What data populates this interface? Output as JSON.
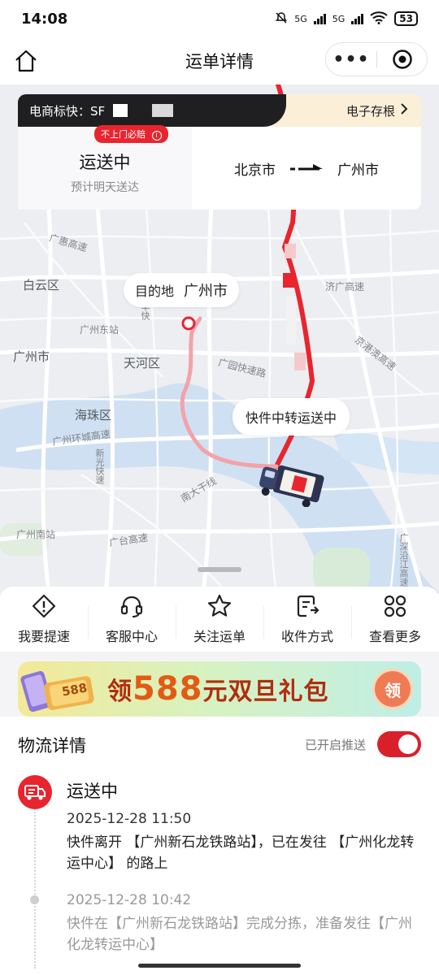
{
  "status_bar": {
    "time": "14:08",
    "network1": "5G",
    "network2": "5G",
    "battery": "53"
  },
  "nav": {
    "title": "运单详情",
    "more": "•••",
    "icons": [
      "home-icon",
      "more-icon",
      "target-icon"
    ]
  },
  "shipment": {
    "waybill_label": "电商标快：SF",
    "waybill_visible_tail": "",
    "e_receipt": "电子存根",
    "badge": "不上门必赔",
    "status": "运送中",
    "eta": "预计明天送达",
    "origin": "北京市",
    "destination": "广州市"
  },
  "map": {
    "destination_prefix": "目的地",
    "destination_city": "广州市",
    "transit_text": "快件中转运送中",
    "labels": {
      "baiyun": "白云区",
      "guangzhou": "广州市",
      "tianhe": "天河区",
      "haizhu": "海珠区",
      "east_station": "广州东站",
      "south_station": "广州南站",
      "jiguang": "济广高速",
      "guangyuan": "广园快速路",
      "huanchengg": "广州环城高速",
      "nanda": "南大干线",
      "guangtai": "广台高速",
      "jinggangao": "京港澳高速",
      "guanghui": "广惠高速",
      "huagui": "华快",
      "xinguang": "新光快速",
      "shenyan": "广深沿江高速"
    },
    "route_color_done": "#e8252f",
    "route_color_todo": "#f3a3a8"
  },
  "actions": [
    {
      "label": "我要提速",
      "icon": "speed-alert-icon"
    },
    {
      "label": "客服中心",
      "icon": "headset-icon"
    },
    {
      "label": "关注运单",
      "icon": "star-icon"
    },
    {
      "label": "收件方式",
      "icon": "receive-method-icon"
    },
    {
      "label": "查看更多",
      "icon": "grid-more-icon"
    }
  ],
  "promo": {
    "prefix": "领",
    "amount": "588",
    "suffix": "元双旦礼包",
    "button": "领",
    "ticket_text": "588"
  },
  "logistics": {
    "title": "物流详情",
    "push_label": "已开启推送",
    "push_on": true,
    "events": [
      {
        "status": "运送中",
        "time": "2025-12-28 11:50",
        "desc": "快件离开 【广州新石龙铁路站】，已在发往 【广州化龙转运中心】 的路上"
      },
      {
        "time": "2025-12-28 10:42",
        "desc": "快件在【广州新石龙铁路站】完成分拣，准备发往【广州化龙转运中心】"
      }
    ]
  },
  "colors": {
    "brand_red": "#e8252f",
    "dark_bar": "#1f1f22"
  }
}
